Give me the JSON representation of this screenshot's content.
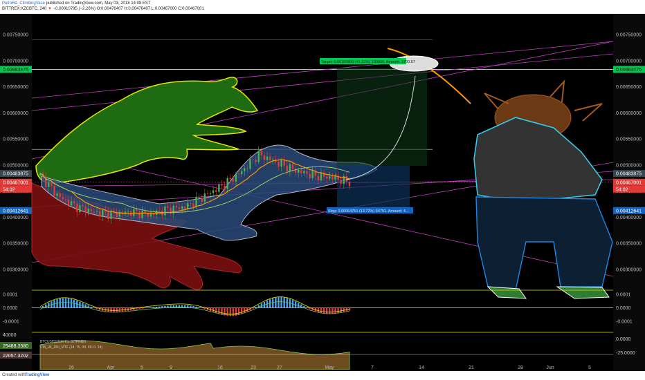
{
  "header": {
    "author": "PetroRa_ClimbingVase",
    "published": "published on TradingView.com, May 03, 2018 14:08 EST",
    "symbol_line": "BITTREX:XZCBTC, 240",
    "arrow": "▼",
    "change": "−0.00010795 (−2.26%)",
    "ohlc": "O:0.00476407 H:0.00476407 L:0.00467000 C:0.00467001"
  },
  "footer": {
    "created": "Created with",
    "brand": "TradingView"
  },
  "colors": {
    "background": "#000000",
    "up": "#4caf50",
    "down": "#e53935",
    "price_line": "#e53935",
    "target_label": "#00c853",
    "stop_label": "#1565c0",
    "drawing_yellow": "#e6e600",
    "drawing_white": "#ffffff",
    "cyan": "#33ccee",
    "magenta": "#c040c0"
  },
  "chart_data": {
    "type": "line",
    "title": "BITTREX:XZCBTC, 240",
    "x_tick_labels": [
      "26",
      "Apr",
      "5",
      "9",
      "16",
      "23",
      "27",
      "May",
      "7",
      "14",
      "21",
      "28",
      "Jun",
      "5"
    ],
    "y_tick_labels": [
      "0.00750000",
      "0.00700000",
      "0.00650000",
      "0.00600000",
      "0.00550000",
      "0.00500000",
      "0.00450000",
      "0.00400000",
      "0.00350000",
      "0.00300000"
    ],
    "y_ticks": [
      0.0075,
      0.007,
      0.0065,
      0.006,
      0.0055,
      0.005,
      0.0045,
      0.004,
      0.0035,
      0.003
    ],
    "ylim": [
      0.0026,
      0.0079
    ],
    "price_labels": {
      "target_level": "0.00683475",
      "upper_level": "0.00483875",
      "last_price": "0.00467001",
      "countdown": "54:02",
      "lower_level": "0.00412641"
    },
    "levels": {
      "target_level": 0.00683475,
      "upper_level": 0.00483875,
      "last_price": 0.00467001,
      "lower_level": 0.00412641
    },
    "target_box_label": "Target: 0.00189800 (41.22%) 189800, Amount: 3700.57",
    "stop_box_label": "Stop: 0.00064751 (13.72%) 64751, Amount: 4...",
    "series": [
      {
        "name": "XZCBTC",
        "dates": [
          "Mar 22",
          "Mar 25",
          "Mar 28",
          "Mar 31",
          "Apr 3",
          "Apr 6",
          "Apr 9",
          "Apr 12",
          "Apr 15",
          "Apr 17",
          "Apr 19",
          "Apr 21",
          "Apr 23",
          "Apr 25",
          "Apr 27",
          "Apr 29",
          "May 1",
          "May 3"
        ],
        "values": [
          0.0048,
          0.0044,
          0.0042,
          0.0041,
          0.00405,
          0.0041,
          0.00405,
          0.00415,
          0.0042,
          0.0044,
          0.0046,
          0.00485,
          0.0052,
          0.00505,
          0.0049,
          0.0048,
          0.00476,
          0.00467
        ]
      }
    ],
    "macd": {
      "y_tick_labels": [
        "0.0001",
        "0.0000",
        "-0.0001"
      ],
      "ylim": [
        -0.00017,
        0.00012
      ]
    },
    "bottom_panel": {
      "legend": [
        "BTCUSDSHORTS, BITFINEX",
        "CM_Ult_RSI_MTF (14, 70, 30, 60, 0, 14)"
      ],
      "left_labels": [
        "40000",
        "29488.3380",
        "22057.3202"
      ],
      "right_labels": [
        "0.0000",
        "-25.0000"
      ]
    },
    "grid": false
  }
}
